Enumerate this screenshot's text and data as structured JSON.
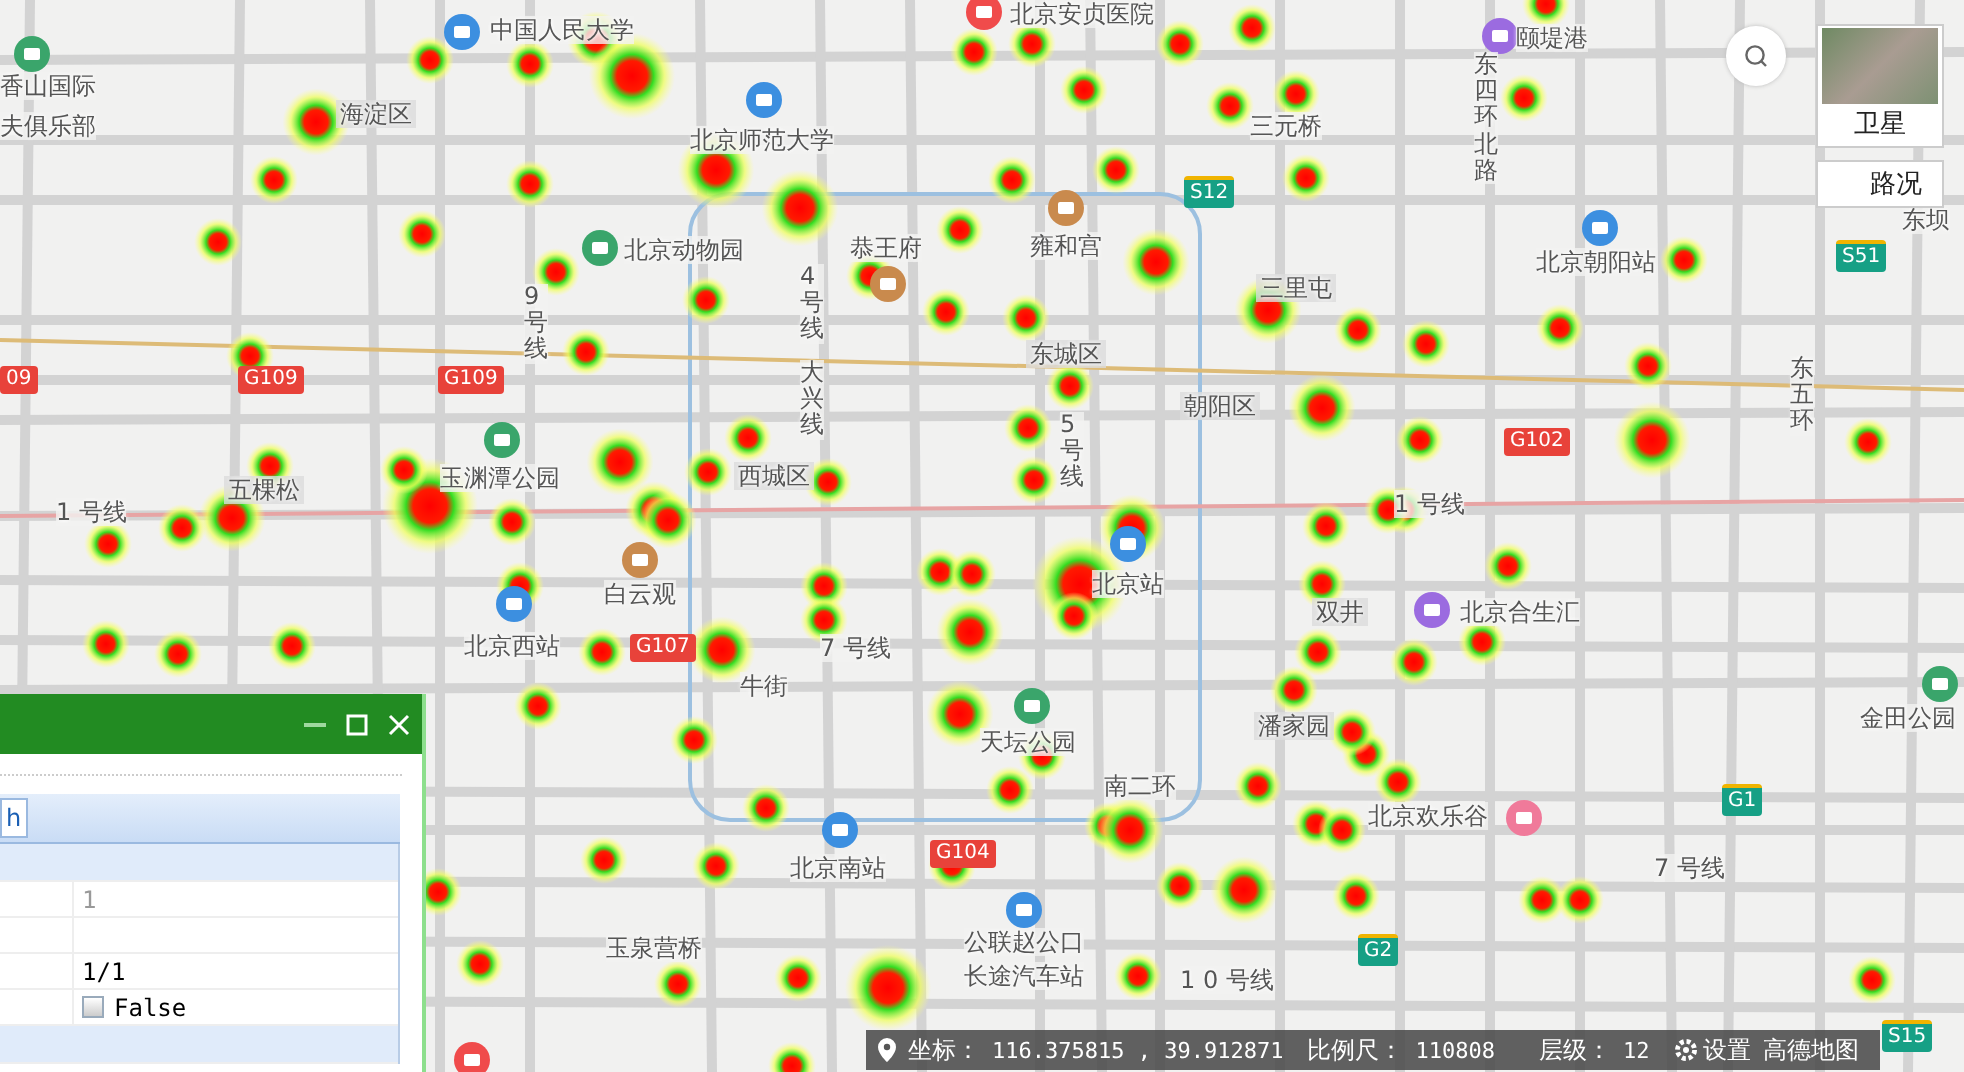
{
  "map": {
    "labels": [
      {
        "text": "中国人民大学",
        "kind": "place"
      },
      {
        "text": "北京安贞医院",
        "kind": "place"
      },
      {
        "text": "颐堤港",
        "kind": "place"
      },
      {
        "text": "香山国际",
        "kind": "place"
      },
      {
        "text": "夫俱乐部",
        "kind": "place"
      },
      {
        "text": "海淀区",
        "kind": "district"
      },
      {
        "text": "北京师范大学",
        "kind": "place"
      },
      {
        "text": "三元桥",
        "kind": "place"
      },
      {
        "text": "北京动物园",
        "kind": "place"
      },
      {
        "text": "恭王府",
        "kind": "place"
      },
      {
        "text": "雍和宫",
        "kind": "place"
      },
      {
        "text": "北京朝阳站",
        "kind": "place"
      },
      {
        "text": "东坝",
        "kind": "place"
      },
      {
        "text": "三里屯",
        "kind": "district"
      },
      {
        "text": "东城区",
        "kind": "district"
      },
      {
        "text": "朝阳区",
        "kind": "district"
      },
      {
        "text": "玉渊潭公园",
        "kind": "place"
      },
      {
        "text": "西城区",
        "kind": "district"
      },
      {
        "text": "五棵松",
        "kind": "district"
      },
      {
        "text": "1 号线",
        "kind": "line"
      },
      {
        "text": "1 号线",
        "kind": "line"
      },
      {
        "text": "白云观",
        "kind": "place"
      },
      {
        "text": "北京站",
        "kind": "place"
      },
      {
        "text": "北京西站",
        "kind": "place"
      },
      {
        "text": "双井",
        "kind": "district"
      },
      {
        "text": "北京合生汇",
        "kind": "place"
      },
      {
        "text": "7 号线",
        "kind": "line"
      },
      {
        "text": "金田公园",
        "kind": "place"
      },
      {
        "text": "天坛公园",
        "kind": "place"
      },
      {
        "text": "潘家园",
        "kind": "district"
      },
      {
        "text": "南二环",
        "kind": "place"
      },
      {
        "text": "北京欢乐谷",
        "kind": "place"
      },
      {
        "text": "7 号线",
        "kind": "line"
      },
      {
        "text": "北京南站",
        "kind": "place"
      },
      {
        "text": "公联赵公口",
        "kind": "place"
      },
      {
        "text": "长途汽车站",
        "kind": "place"
      },
      {
        "text": "玉泉营桥",
        "kind": "place"
      },
      {
        "text": "1 0 号线",
        "kind": "line"
      },
      {
        "text": "牛街",
        "kind": "place"
      },
      {
        "text": "9号线",
        "kind": "vertical"
      },
      {
        "text": "4号线",
        "kind": "vertical"
      },
      {
        "text": "大兴线",
        "kind": "vertical"
      },
      {
        "text": "5号线",
        "kind": "vertical"
      },
      {
        "text": "东五环",
        "kind": "vertical"
      },
      {
        "text": "东四环北路",
        "kind": "vertical"
      },
      {
        "text": "09",
        "kind": "shield_red"
      },
      {
        "text": "G109",
        "kind": "shield_red"
      },
      {
        "text": "G109",
        "kind": "shield_red"
      },
      {
        "text": "S12",
        "kind": "shield_green"
      },
      {
        "text": "S51",
        "kind": "shield_green"
      },
      {
        "text": "G102",
        "kind": "shield_red"
      },
      {
        "text": "G107",
        "kind": "shield_red"
      },
      {
        "text": "G104",
        "kind": "shield_red"
      },
      {
        "text": "G2",
        "kind": "shield_green"
      },
      {
        "text": "G1",
        "kind": "shield_green"
      },
      {
        "text": "S15",
        "kind": "shield_green"
      }
    ]
  },
  "layer_switch": [
    {
      "label": "卫星",
      "kind": "satellite"
    },
    {
      "label": "路况",
      "kind": "traffic"
    }
  ],
  "panel": {
    "toolbar_button": "h",
    "rows": [
      {
        "value": "1",
        "kind": "muted"
      },
      {
        "value": "",
        "kind": "text"
      },
      {
        "value": "1/1",
        "kind": "text"
      },
      {
        "value": "False",
        "kind": "checkbox",
        "checked": false
      }
    ]
  },
  "status_bar": {
    "coord_label": "坐标：",
    "coord_value": "116.375815 , 39.912871",
    "scale_label": "比例尺：",
    "scale_value": "110808",
    "zoom_label": "层级：",
    "zoom_value": "12",
    "settings": "设置",
    "provider": "高德地图"
  }
}
